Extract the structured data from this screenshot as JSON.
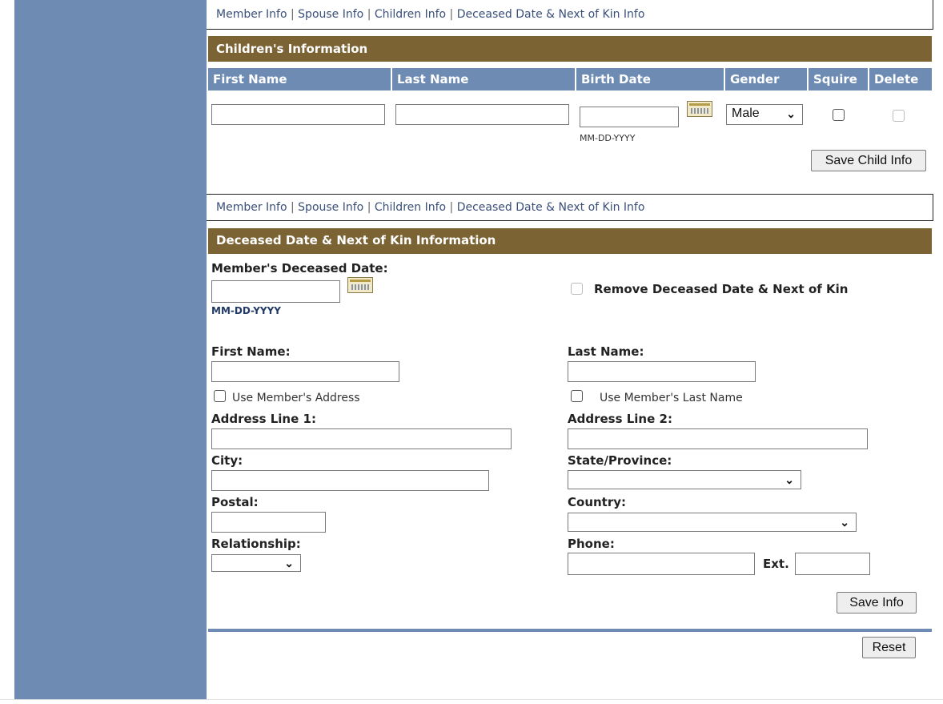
{
  "nav": {
    "member": "Member Info",
    "spouse": "Spouse Info",
    "children": "Children Info",
    "deceased": "Deceased Date & Next of Kin Info",
    "separator": "|"
  },
  "children_section": {
    "title": "Children's Information",
    "columns": [
      "First Name",
      "Last Name",
      "Birth Date",
      "Gender",
      "Squire",
      "Delete"
    ],
    "birth_date_hint": "MM-DD-YYYY",
    "gender_value": "Male",
    "save_label": "Save Child Info"
  },
  "deceased_section": {
    "title": "Deceased Date & Next of Kin Information",
    "deceased_date_label": "Member's Deceased Date:",
    "date_hint": "MM-DD-YYYY",
    "remove_label": "Remove Deceased Date & Next of Kin",
    "first_name_label": "First Name:",
    "last_name_label": "Last Name:",
    "use_address_label": "Use Member's Address",
    "use_last_name_label": "Use Member's Last Name",
    "address1_label": "Address Line 1:",
    "address2_label": "Address Line 2:",
    "city_label": "City:",
    "state_label": "State/Province:",
    "postal_label": "Postal:",
    "country_label": "Country:",
    "relationship_label": "Relationship:",
    "phone_label": "Phone:",
    "ext_label": "Ext.",
    "save_label": "Save Info",
    "reset_label": "Reset"
  },
  "icons": {
    "calendar": "calendar-icon",
    "dropdown": "chevron-down-icon"
  },
  "colors": {
    "sidebar": "#6d8bb3",
    "section_header": "#7b6333",
    "column_header": "#6d8bb3",
    "link": "#3a4f7a"
  }
}
